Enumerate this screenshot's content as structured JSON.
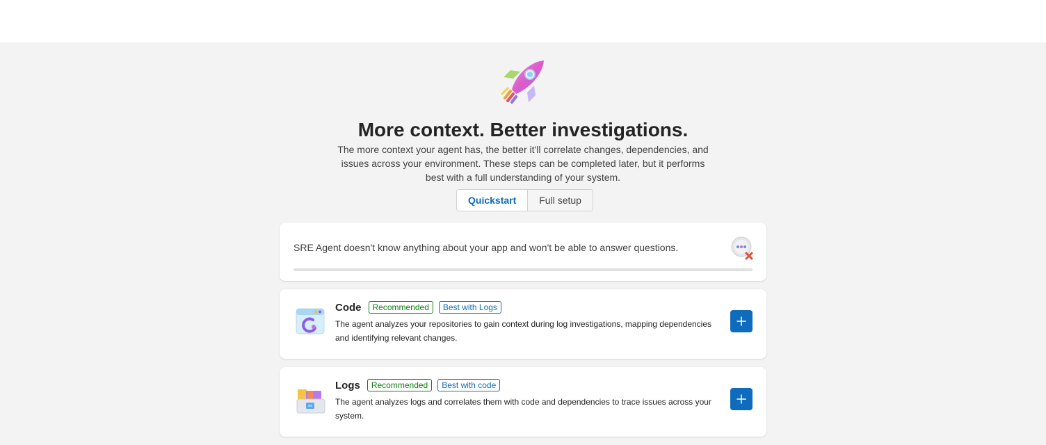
{
  "hero": {
    "icon": "rocket-icon",
    "title": "More context. Better investigations.",
    "description": "The more context your agent has, the better it'll correlate changes, dependencies, and issues across your environment. These steps can be completed later, but it performs best with a full understanding of your system."
  },
  "setup_mode": {
    "options": [
      "Quickstart",
      "Full setup"
    ],
    "selected": "Quickstart"
  },
  "status": {
    "message": "SRE Agent doesn't know anything about your app and won't be able to answer questions.",
    "icon": "chat-error-icon",
    "progress": 0
  },
  "items": [
    {
      "title": "Code",
      "badges": [
        "Recommended",
        "Best with Logs"
      ],
      "description": "The agent analyzes your repositories to gain context during log investigations, mapping dependencies and identifying relevant changes.",
      "icon": "code-window-icon"
    },
    {
      "title": "Logs",
      "badges": [
        "Recommended",
        "Best with code"
      ],
      "description": "The agent analyzes logs and correlates them with code and dependencies to trace issues across your system.",
      "icon": "logs-folder-icon"
    }
  ],
  "colors": {
    "accent": "#0f6cbd",
    "recommended": "#107c10",
    "background": "#f3f3f3"
  }
}
